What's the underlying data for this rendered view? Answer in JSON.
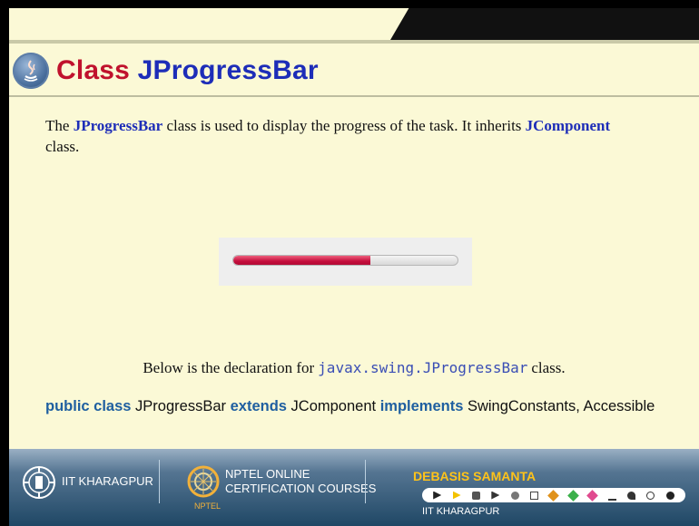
{
  "slide": {
    "title_prefix": "Class ",
    "title_highlight": "JProgressBar",
    "paragraph": {
      "t1": "The ",
      "k1": "JProgressBar",
      "t2": " class is used to display the progress of the task. It inherits ",
      "k2": "JComponent",
      "t3": " class."
    },
    "progress_bar": {
      "value_fraction": 0.61,
      "fill_color": "#c40e3c"
    },
    "declaration": {
      "prefix": "Below is the declaration for",
      "code": "javax.swing.JProgressBar",
      "suffix": "class."
    },
    "signature": {
      "k1": "public class",
      "t1": " JProgressBar ",
      "k2": "extends",
      "t2": " JComponent ",
      "k3": "implements",
      "t3": " SwingConstants, Accessible"
    }
  },
  "footer": {
    "institute": "IIT KHARAGPUR",
    "nptel_line1": "NPTEL ONLINE",
    "nptel_line2": "CERTIFICATION COURSES",
    "nptel_small": "NPTEL",
    "presenter": "DEBASIS SAMANTA",
    "presenter_institute": "IIT KHARAGPUR"
  },
  "colors": {
    "background": "#fbf9d6",
    "title": "#c0122d",
    "keyword": "#1d2db8",
    "signature_keyword": "#1f5fa0",
    "footer": "#1f4765",
    "presenter": "#ffc31a"
  },
  "icons": [
    "java-logo-icon",
    "iit-emblem-icon",
    "nptel-logo-icon",
    "annotation-toolbar-icons"
  ]
}
